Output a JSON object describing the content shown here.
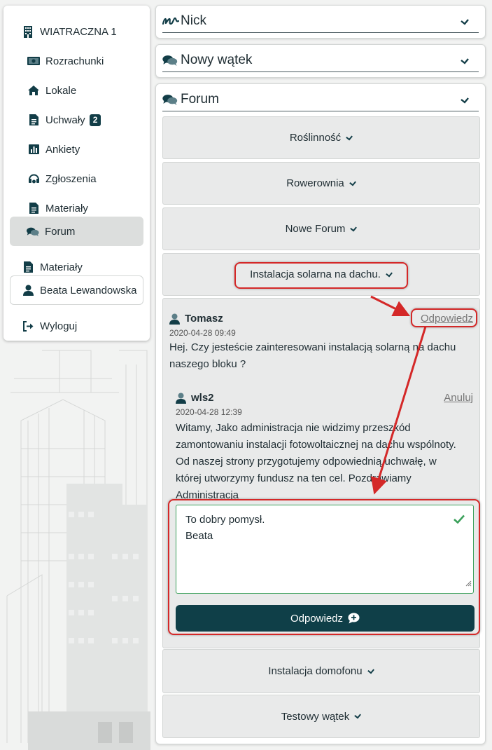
{
  "sidebar": {
    "building": "WIATRACZNA 1",
    "items": [
      {
        "label": "Rozrachunki",
        "icon": "money-icon"
      },
      {
        "label": "Lokale",
        "icon": "home-icon"
      },
      {
        "label": "Uchwały",
        "icon": "document-icon",
        "badge": "2"
      },
      {
        "label": "Ankiety",
        "icon": "bar-chart-icon"
      },
      {
        "label": "Zgłoszenia",
        "icon": "headset-icon"
      },
      {
        "label": "Materiały",
        "icon": "document-icon"
      },
      {
        "label": "Forum",
        "icon": "comments-icon",
        "active": true
      }
    ],
    "materials": "Materiały",
    "user": "Beata Lewandowska",
    "logout": "Wyloguj"
  },
  "panels": {
    "nick": "Nick",
    "new_thread": "Nowy wątek",
    "forum": "Forum"
  },
  "forum": {
    "threads_top": [
      "Roślinność",
      "Rowerownia",
      "Nowe Forum"
    ],
    "open_thread": "Instalacja solarna na dachu.",
    "threads_bottom": [
      "Instalacja domofonu",
      "Testowy wątek"
    ],
    "post": {
      "author": "Tomasz",
      "date": "2020-04-28 09:49",
      "reply_link": "Odpowiedz",
      "body_line1": "Hej. Czy jesteście zainteresowani instalacją solarną na dachu",
      "body_line2": "naszego bloku ?"
    },
    "reply": {
      "author": "wls2",
      "date": "2020-04-28 12:39",
      "cancel_link": "Anuluj",
      "body_lines": [
        "Witamy, Jako administracja nie widzimy przeszkód",
        "zamontowaniu instalacji fotowoltaicznej na dachu wspólnoty.",
        "Od naszej strony przygotujemy odpowiednią uchwałę, w",
        "której utworzymy fundusz na ten cel. Pozdrawiamy",
        "Administracja"
      ]
    },
    "textarea_line1": "To dobry pomysł.",
    "textarea_line2": "Beata",
    "submit_label": "Odpowiedz"
  },
  "colors": {
    "primary": "#0f3f48",
    "highlight": "#d42828",
    "valid": "#3aa05a",
    "thread_bg": "#e9eaea"
  }
}
